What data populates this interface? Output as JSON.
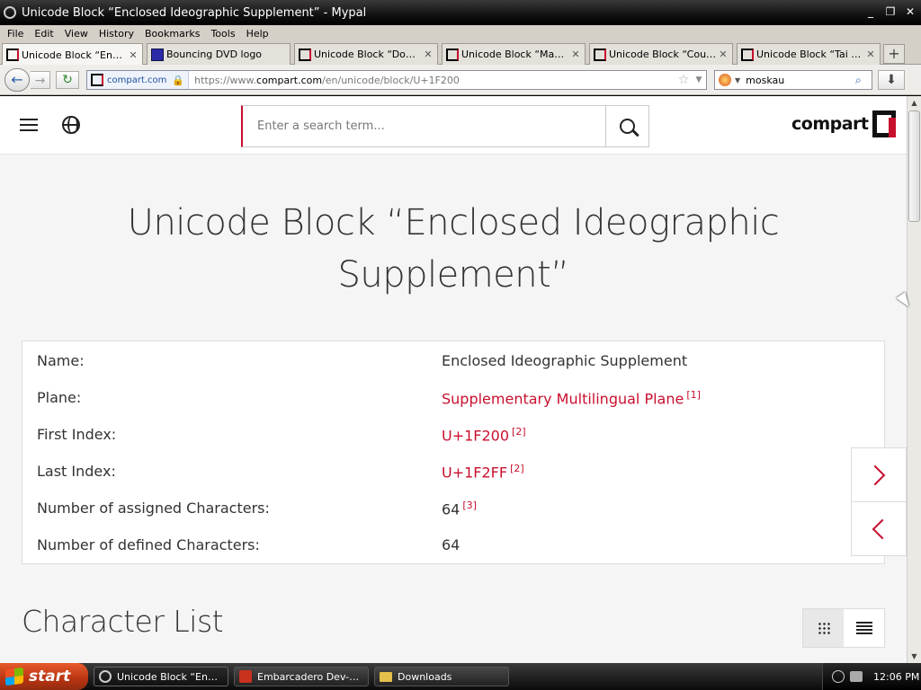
{
  "window": {
    "title": "Unicode Block “Enclosed Ideographic Supplement” - Mypal",
    "min": "_",
    "max": "❐",
    "close": "✕"
  },
  "menu": [
    "File",
    "Edit",
    "View",
    "History",
    "Bookmarks",
    "Tools",
    "Help"
  ],
  "tabs": [
    {
      "label": "Unicode Block “Enclose...",
      "active": true
    },
    {
      "label": "Bouncing DVD logo",
      "active": false
    },
    {
      "label": "Unicode Block “Domino ...",
      "active": false
    },
    {
      "label": "Unicode Block “Mahjon...",
      "active": false
    },
    {
      "label": "Unicode Block “Countin...",
      "active": false
    },
    {
      "label": "Unicode Block “Tai Xua...",
      "active": false
    }
  ],
  "tab_close_glyph": "✕",
  "new_tab_glyph": "+",
  "nav": {
    "back_glyph": "←",
    "forward_glyph": "→",
    "reload_glyph": "↻",
    "identity": "compart.com",
    "url_prefix": "https://www.",
    "url_host": "compart.com",
    "url_path": "/en/unicode/block/U+1F200",
    "search_value": "moskau",
    "star_glyph": "☆",
    "download_glyph": "⬇"
  },
  "site": {
    "search_placeholder": "Enter a search term...",
    "logo_text": "compart"
  },
  "page": {
    "headline_line1": "Unicode Block “Enclosed Ideographic",
    "headline_line2": "Supplement”",
    "rows": [
      {
        "key": "Name:",
        "value": "Enclosed Ideographic Supplement",
        "link": false,
        "ref": ""
      },
      {
        "key": "Plane:",
        "value": "Supplementary Multilingual Plane",
        "link": true,
        "ref": "[1]"
      },
      {
        "key": "First Index:",
        "value": "U+1F200",
        "link": true,
        "ref": "[2]"
      },
      {
        "key": "Last Index:",
        "value": "U+1F2FF",
        "link": true,
        "ref": "[2]"
      },
      {
        "key": "Number of assigned Characters:",
        "value": "64",
        "link": false,
        "ref": "[3]"
      },
      {
        "key": "Number of defined Characters:",
        "value": "64",
        "link": false,
        "ref": ""
      }
    ],
    "section_title": "Character List"
  },
  "taskbar": {
    "start_label": "start",
    "tasks": [
      {
        "label": "Unicode Block “Enclos...",
        "icon": "browser-icon",
        "active": true
      },
      {
        "label": "Embarcadero Dev-C++",
        "icon": "devcpp-icon",
        "active": false
      },
      {
        "label": "Downloads",
        "icon": "folder-icon",
        "active": false
      }
    ],
    "clock": "12:06 PM"
  },
  "colors": {
    "accent": "#c8102e",
    "text": "#333333"
  }
}
